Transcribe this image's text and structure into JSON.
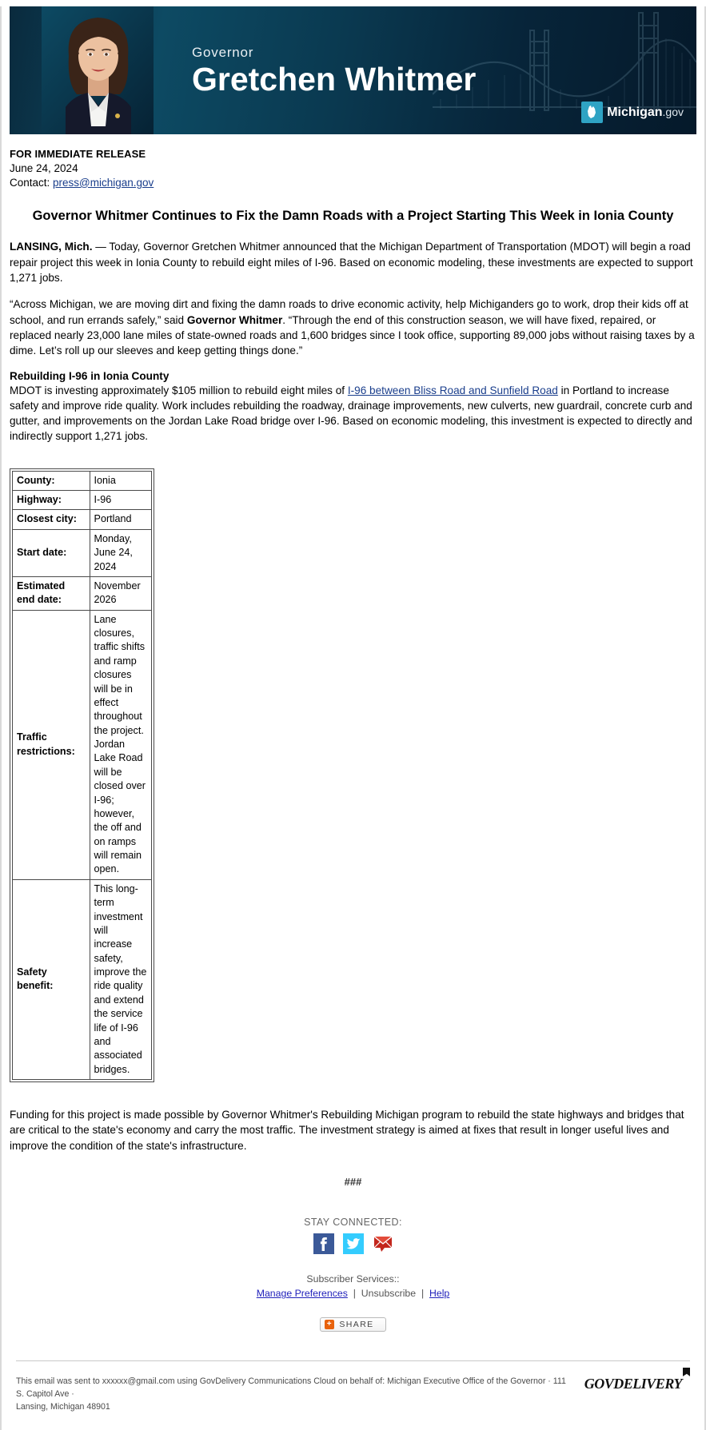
{
  "banner": {
    "eyebrow": "Governor",
    "name": "Gretchen Whitmer",
    "logo_text": "Michigan",
    "logo_suffix": ".gov",
    "portrait_alt": "governor-portrait"
  },
  "release": {
    "label": "FOR IMMEDIATE RELEASE",
    "date": "June 24, 2024",
    "contact_prefix": "Contact: ",
    "contact_email": "press@michigan.gov"
  },
  "headline": "Governor Whitmer Continues to Fix the Damn Roads with a Project Starting This Week in Ionia County",
  "paragraphs": {
    "lead_dateline": "LANSING, Mich.",
    "lead_rest": "  —  Today, Governor Gretchen Whitmer announced that the Michigan Department of Transportation (MDOT) will begin a road repair project this week in Ionia County to rebuild eight miles of I-96. Based on economic modeling, these investments are expected to support 1,271 jobs.",
    "quote_part1": "“Across Michigan, we are moving dirt and fixing the damn roads to drive economic activity, help Michiganders go to work, drop their kids off at school, and run errands safely,” said ",
    "quote_attrib": "Governor Whitmer",
    "quote_part2": ". “Through the end of this construction season, we will have fixed, repaired, or replaced nearly 23,000 lane miles of state-owned roads and 1,600 bridges since I took office, supporting 89,000 jobs without raising taxes by a dime. Let’s roll up our sleeves and keep getting things done.”",
    "section_heading": "Rebuilding I-96 in Ionia County",
    "section_part1": "MDOT is investing approximately $105 million to rebuild eight miles of ",
    "section_link": "I-96 between Bliss Road and Sunfield Road",
    "section_part2": " in Portland to increase safety and improve ride quality. Work includes rebuilding the roadway, drainage improvements, new culverts, new guardrail, concrete curb and gutter, and improvements on the Jordan Lake Road bridge over I-96. Based on economic modeling, this investment is expected to directly and indirectly support 1,271 jobs.",
    "closing": "Funding for this project is made possible by Governor Whitmer's Rebuilding Michigan program to rebuild the state highways and bridges that are critical to the state's economy and carry the most traffic. The investment strategy is aimed at fixes that result in longer useful lives and improve the condition of the state's infrastructure.",
    "end_marker": "###"
  },
  "project_table": {
    "rows": [
      {
        "key": "County:",
        "value": "Ionia"
      },
      {
        "key": "Highway:",
        "value": "I-96"
      },
      {
        "key": "Closest city:",
        "value": "Portland"
      },
      {
        "key": "Start date:",
        "value": "Monday, June 24, 2024"
      },
      {
        "key": "Estimated end date:",
        "value": "November 2026"
      },
      {
        "key": "Traffic restrictions:",
        "value": "Lane closures, traffic shifts and ramp closures will be in effect throughout the project. Jordan Lake Road will be closed over I-96; however, the off and on ramps will remain open."
      },
      {
        "key": "Safety benefit:",
        "value": "This long-term investment will increase safety, improve the ride quality and extend the service life of I-96 and associated bridges."
      }
    ]
  },
  "footer": {
    "stay_connected": "STAY CONNECTED:",
    "social": [
      {
        "name": "facebook-icon",
        "glyph": "f"
      },
      {
        "name": "twitter-icon",
        "glyph": ""
      },
      {
        "name": "email-icon",
        "glyph": ""
      }
    ],
    "subscriber_label": "Subscriber Services::",
    "manage_preferences": "Manage Preferences",
    "unsubscribe": "Unsubscribe",
    "help": "Help",
    "separator": "|",
    "share_label": "SHARE",
    "share_plus": "+",
    "legal_line1": "This email was sent to xxxxxx@gmail.com using GovDelivery Communications Cloud on behalf of: Michigan Executive Office of the Governor · 111 S. Capitol Ave ·",
    "legal_line2": "Lansing, Michigan 48901",
    "brand": "govdelivery"
  },
  "colors": {
    "banner_dark": "#05192a",
    "banner_teal": "#0d4a63",
    "link": "#1a3e8c",
    "facebook": "#3b5998",
    "twitter": "#34ccfe",
    "email_red": "#c3261c",
    "share_orange": "#e8620c"
  }
}
